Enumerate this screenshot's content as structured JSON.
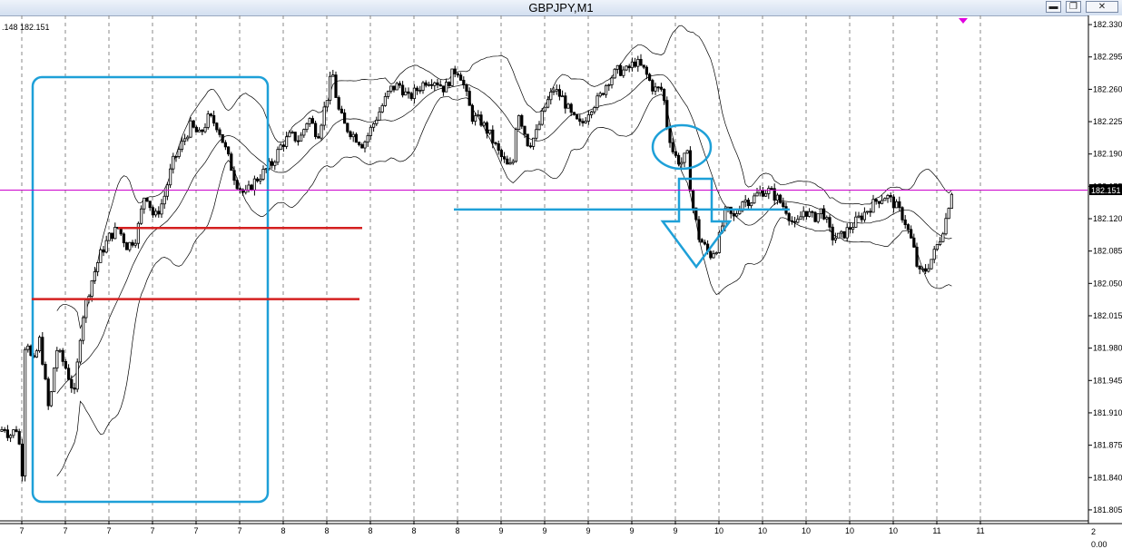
{
  "window": {
    "title": "GBPJPY,M1",
    "min_label": "▬",
    "restore_label": "❐",
    "close_label": "✕"
  },
  "info_label": ".148 182.151",
  "indicator_ticks": [
    "2",
    "0.00"
  ],
  "colors": {
    "candle": "#000000",
    "band": "#000000",
    "bid_line": "#cc00cc",
    "marker": "#e000e0",
    "annotation_blue": "#1ea0d8",
    "annotation_red": "#d42020",
    "grid": "#888888"
  },
  "chart_data": {
    "type": "candlestick",
    "symbol": "GBPJPY",
    "timeframe": "M1",
    "ylim": [
      181.8,
      182.335
    ],
    "y_ticks": [
      181.805,
      181.84,
      181.875,
      181.91,
      181.945,
      181.98,
      182.015,
      182.05,
      182.085,
      182.12,
      182.155,
      182.19,
      182.225,
      182.26,
      182.295,
      182.33
    ],
    "y_tick_labels": [
      "181.805",
      "181.840",
      "181.875",
      "181.910",
      "181.945",
      "181.980",
      "182.015",
      "182.050",
      "182.085",
      "182.120",
      "182.155",
      "182.190",
      "182.225",
      "182.260",
      "182.295",
      "182.330"
    ],
    "current_price": 182.151,
    "current_price_label": "182.151",
    "x_labels": [
      "7",
      "7",
      "7",
      "7",
      "7",
      "7",
      "8",
      "8",
      "8",
      "8",
      "8",
      "9",
      "9",
      "9",
      "9",
      "9",
      "10",
      "10",
      "10",
      "10",
      "10",
      "11",
      "11"
    ],
    "price_path": [
      [
        0,
        181.89
      ],
      [
        5,
        181.895
      ],
      [
        10,
        181.885
      ],
      [
        20,
        181.895
      ],
      [
        24,
        181.83
      ],
      [
        28,
        182.0
      ],
      [
        36,
        181.96
      ],
      [
        44,
        181.99
      ],
      [
        54,
        181.91
      ],
      [
        62,
        181.98
      ],
      [
        72,
        181.96
      ],
      [
        82,
        181.93
      ],
      [
        90,
        182.01
      ],
      [
        100,
        182.05
      ],
      [
        110,
        182.08
      ],
      [
        120,
        182.1
      ],
      [
        130,
        182.11
      ],
      [
        140,
        182.09
      ],
      [
        150,
        182.1
      ],
      [
        160,
        182.15
      ],
      [
        170,
        182.12
      ],
      [
        180,
        182.14
      ],
      [
        190,
        182.18
      ],
      [
        200,
        182.2
      ],
      [
        210,
        182.22
      ],
      [
        220,
        182.21
      ],
      [
        230,
        182.23
      ],
      [
        240,
        182.22
      ],
      [
        250,
        182.19
      ],
      [
        260,
        182.16
      ],
      [
        270,
        182.145
      ],
      [
        280,
        182.16
      ],
      [
        290,
        182.17
      ],
      [
        300,
        182.18
      ],
      [
        310,
        182.2
      ],
      [
        320,
        182.21
      ],
      [
        330,
        182.205
      ],
      [
        340,
        182.23
      ],
      [
        350,
        182.21
      ],
      [
        360,
        182.25
      ],
      [
        366,
        182.28
      ],
      [
        372,
        182.24
      ],
      [
        380,
        182.22
      ],
      [
        390,
        182.21
      ],
      [
        400,
        182.2
      ],
      [
        410,
        182.22
      ],
      [
        420,
        182.24
      ],
      [
        430,
        182.26
      ],
      [
        440,
        182.265
      ],
      [
        450,
        182.25
      ],
      [
        460,
        182.26
      ],
      [
        470,
        182.27
      ],
      [
        480,
        182.27
      ],
      [
        490,
        182.26
      ],
      [
        500,
        182.28
      ],
      [
        506,
        182.28
      ],
      [
        512,
        182.26
      ],
      [
        520,
        182.23
      ],
      [
        530,
        182.225
      ],
      [
        540,
        182.21
      ],
      [
        550,
        182.19
      ],
      [
        560,
        182.175
      ],
      [
        565,
        182.18
      ],
      [
        570,
        182.24
      ],
      [
        576,
        182.22
      ],
      [
        582,
        182.2
      ],
      [
        590,
        182.21
      ],
      [
        600,
        182.24
      ],
      [
        610,
        182.26
      ],
      [
        620,
        182.25
      ],
      [
        630,
        182.23
      ],
      [
        640,
        182.22
      ],
      [
        650,
        182.24
      ],
      [
        660,
        182.25
      ],
      [
        670,
        182.27
      ],
      [
        680,
        182.28
      ],
      [
        690,
        182.28
      ],
      [
        700,
        182.29
      ],
      [
        710,
        182.28
      ],
      [
        720,
        182.26
      ],
      [
        730,
        182.26
      ],
      [
        735,
        182.22
      ],
      [
        742,
        182.19
      ],
      [
        750,
        182.18
      ],
      [
        757,
        182.19
      ],
      [
        762,
        182.14
      ],
      [
        770,
        182.1
      ],
      [
        776,
        182.09
      ],
      [
        782,
        182.08
      ],
      [
        790,
        182.09
      ],
      [
        800,
        182.13
      ],
      [
        808,
        182.12
      ],
      [
        818,
        182.14
      ],
      [
        828,
        182.14
      ],
      [
        838,
        182.15
      ],
      [
        848,
        182.15
      ],
      [
        858,
        182.14
      ],
      [
        866,
        182.13
      ],
      [
        876,
        182.11
      ],
      [
        886,
        182.13
      ],
      [
        896,
        182.12
      ],
      [
        906,
        182.13
      ],
      [
        916,
        182.1
      ],
      [
        926,
        182.1
      ],
      [
        936,
        182.11
      ],
      [
        946,
        182.12
      ],
      [
        956,
        182.13
      ],
      [
        966,
        182.14
      ],
      [
        976,
        182.145
      ],
      [
        986,
        182.135
      ],
      [
        996,
        182.12
      ],
      [
        1006,
        182.09
      ],
      [
        1012,
        182.06
      ],
      [
        1020,
        182.065
      ],
      [
        1028,
        182.08
      ],
      [
        1036,
        182.1
      ],
      [
        1042,
        182.12
      ],
      [
        1048,
        182.15
      ],
      [
        1052,
        182.15
      ]
    ],
    "red_lines": [
      [
        130,
        399,
        182.11
      ],
      [
        35,
        396,
        182.033
      ]
    ],
    "blue_hline": [
      500,
      870,
      182.13
    ]
  }
}
